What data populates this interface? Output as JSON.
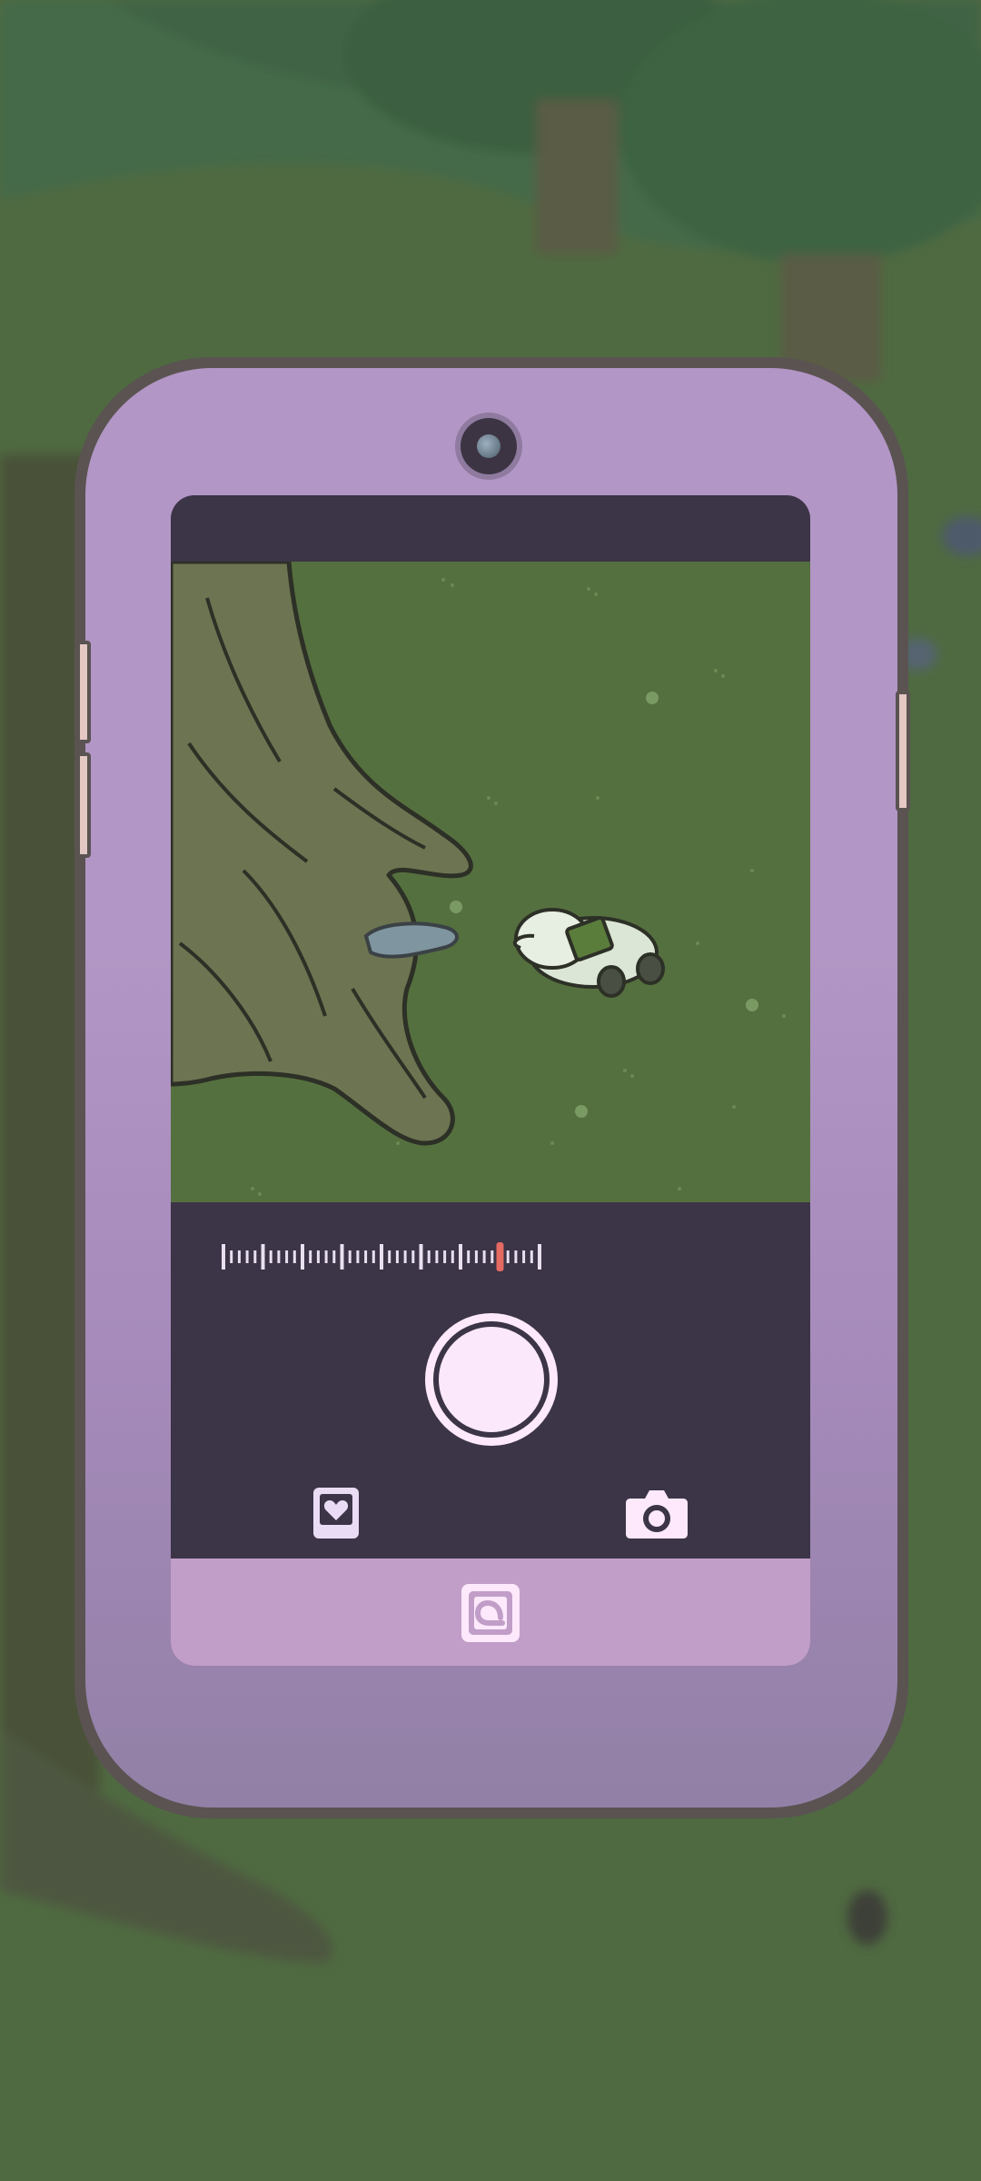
{
  "scene": {
    "background_description_color": "#4f6a41",
    "accent_colors": {
      "phone_frame": "#b296c5",
      "phone_outline": "#5a5352",
      "screen_panel": "#3c3447",
      "bottom_bar": "#c19ec8",
      "grass": "#55703f",
      "zoom_indicator": "#e46a62"
    }
  },
  "camera_app": {
    "zoom": {
      "indicator_color": "#e46a62"
    },
    "controls": {
      "shutter_icon": "shutter-circle",
      "gallery_icon": "photo-heart-icon",
      "switch_icon": "camera-icon",
      "album_icon": "album-icon"
    }
  }
}
